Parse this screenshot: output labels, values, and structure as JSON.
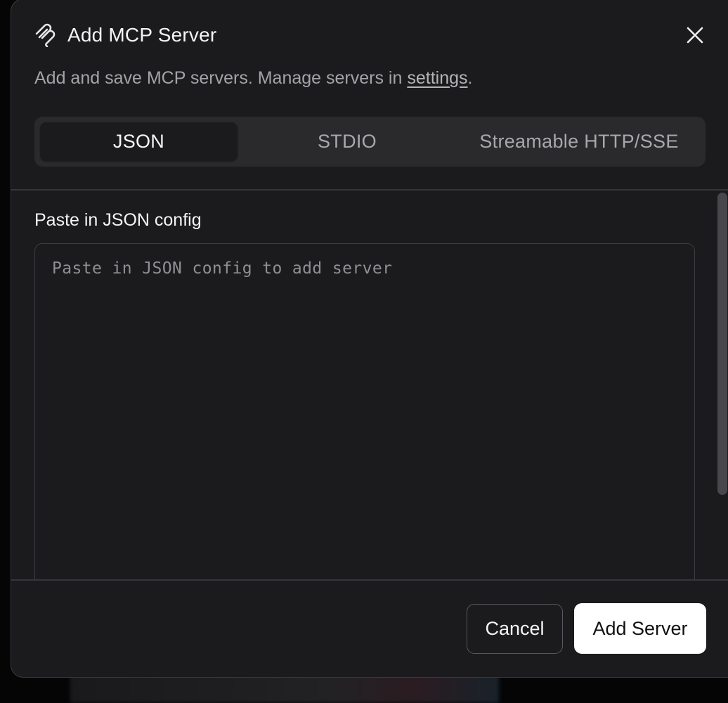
{
  "dialog": {
    "title": "Add MCP Server",
    "title_icon": "mcp-icon",
    "close_icon": "close-icon",
    "subtitle_text": "Add and save MCP servers. Manage servers in ",
    "subtitle_link": "settings",
    "subtitle_end": "."
  },
  "tabs": [
    {
      "label": "JSON",
      "active": true
    },
    {
      "label": "STDIO",
      "active": false
    },
    {
      "label": "Streamable HTTP/SSE",
      "active": false
    }
  ],
  "form": {
    "label": "Paste in JSON config",
    "placeholder": "Paste in JSON config to add server",
    "value": ""
  },
  "footer": {
    "cancel_label": "Cancel",
    "submit_label": "Add Server"
  },
  "colors": {
    "dialog_bg": "#1b1b1d",
    "tabs_bg": "#2a2a2d",
    "primary_button_bg": "#ffffff",
    "text_primary": "#f4f4f5",
    "text_muted": "#a3a3a8"
  }
}
